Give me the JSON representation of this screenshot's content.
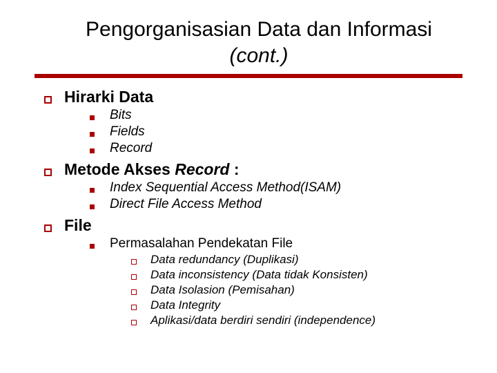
{
  "title_plain": "Pengorganisasian Data dan Informasi ",
  "title_italic": "(cont.)",
  "sections": {
    "s1": {
      "heading": "Hirarki Data",
      "items": [
        "Bits",
        "Fields",
        "Record"
      ]
    },
    "s2": {
      "heading_plain": "Metode Akses  ",
      "heading_italic": "Record ",
      "heading_tail": ":",
      "items": [
        "Index Sequential Access Method(ISAM)",
        "Direct File Access Method"
      ]
    },
    "s3": {
      "heading": "File",
      "sub_heading": "Permasalahan Pendekatan File",
      "items": [
        "Data redundancy (Duplikasi)",
        "Data inconsistency (Data tidak Konsisten)",
        "Data Isolasion (Pemisahan)",
        "Data Integrity",
        "Aplikasi/data berdiri sendiri (independence)"
      ]
    }
  }
}
